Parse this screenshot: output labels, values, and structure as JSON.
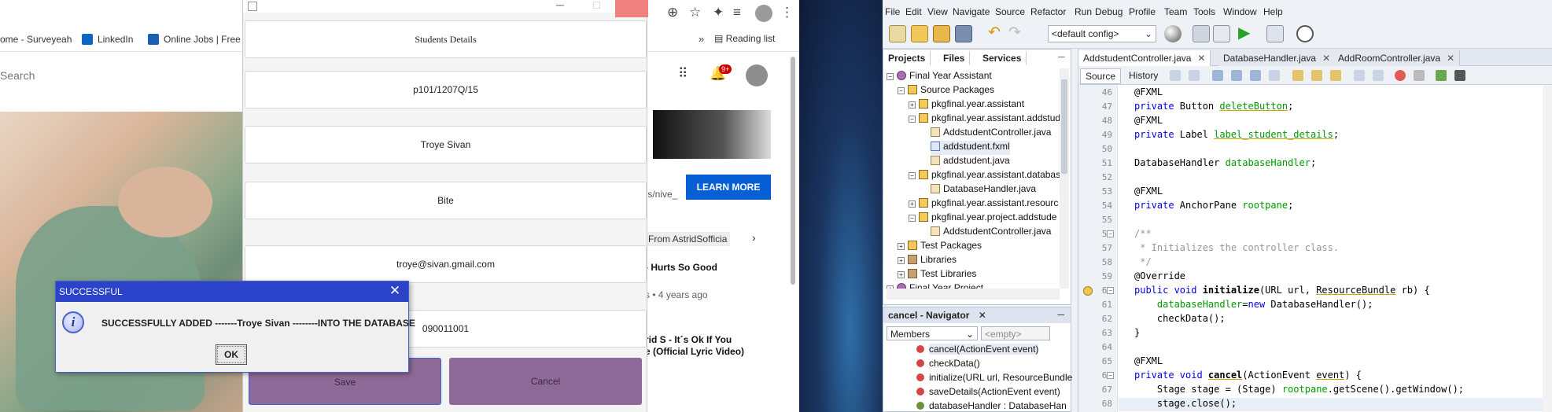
{
  "browser": {
    "bookmarks": [
      "ome - Surveyeah",
      "LinkedIn",
      "Online Jobs | Free"
    ],
    "reading_list": "Reading list",
    "search_placeholder": "Search",
    "notif_count": "9+",
    "ad_caption": "/s/nive_",
    "learn_more": "LEARN MORE",
    "chip": "From AstridSofficia",
    "video1_title": "- Hurts So Good",
    "video1_meta": "s • 4 years ago",
    "video2_title": "rid S - It´s Ok If You",
    "video2_sub": "e (Official Lyric Video)"
  },
  "fx": {
    "title_field": "Students Details",
    "id_field": "p101/1207Q/15",
    "name_field": "Troye Sivan",
    "course_field": "Bite",
    "email_field": "troye@sivan.gmail.com",
    "phone_field": "090011001",
    "save": "Save",
    "cancel": "Cancel"
  },
  "dialog": {
    "title": "SUCCESSFUL",
    "message": "SUCCESSFULLY ADDED -------Troye Sivan --------INTO THE DATABASE",
    "ok": "OK",
    "close": "✕"
  },
  "netbeans": {
    "menu": [
      "File",
      "Edit",
      "View",
      "Navigate",
      "Source",
      "Refactor",
      "Run",
      "Debug",
      "Profile",
      "Team",
      "Tools",
      "Window",
      "Help"
    ],
    "config": "<default config>",
    "project_tabs": [
      "Projects",
      "Files",
      "Services"
    ],
    "tree": [
      {
        "label": "Final Year Assistant",
        "indent": 0,
        "icon": "cup",
        "exp": "−"
      },
      {
        "label": "Source Packages",
        "indent": 1,
        "icon": "pkg",
        "exp": "−"
      },
      {
        "label": "pkgfinal.year.assistant",
        "indent": 2,
        "icon": "pkg",
        "exp": "+"
      },
      {
        "label": "pkgfinal.year.assistant.addstud",
        "indent": 2,
        "icon": "pkg",
        "exp": "−"
      },
      {
        "label": "AddstudentController.java",
        "indent": 3,
        "icon": "java",
        "exp": ""
      },
      {
        "label": "addstudent.fxml",
        "indent": 3,
        "icon": "fxml",
        "exp": ""
      },
      {
        "label": "addstudent.java",
        "indent": 3,
        "icon": "java",
        "exp": ""
      },
      {
        "label": "pkgfinal.year.assistant.databas",
        "indent": 2,
        "icon": "pkg",
        "exp": "−"
      },
      {
        "label": "DatabaseHandler.java",
        "indent": 3,
        "icon": "java",
        "exp": ""
      },
      {
        "label": "pkgfinal.year.assistant.resourc",
        "indent": 2,
        "icon": "pkg",
        "exp": "+"
      },
      {
        "label": "pkgfinal.year.project.addstude",
        "indent": 2,
        "icon": "pkg",
        "exp": "−"
      },
      {
        "label": "AddstudentController.java",
        "indent": 3,
        "icon": "java",
        "exp": ""
      },
      {
        "label": "Test Packages",
        "indent": 1,
        "icon": "pkg",
        "exp": "+"
      },
      {
        "label": "Libraries",
        "indent": 1,
        "icon": "lib",
        "exp": "+"
      },
      {
        "label": "Test Libraries",
        "indent": 1,
        "icon": "lib",
        "exp": "+"
      },
      {
        "label": "Final Year Project",
        "indent": 0,
        "icon": "cup",
        "exp": "+"
      }
    ],
    "navigator_title": "cancel - Navigator",
    "navigator_members": "Members",
    "navigator_filter": "<empty>",
    "navigator_items": [
      "cancel(ActionEvent event)",
      "checkData()",
      "initialize(URL url, ResourceBundle",
      "saveDetails(ActionEvent event)",
      "databaseHandler : DatabaseHan"
    ],
    "editor_tabs": [
      "AddstudentController.java",
      "DatabaseHandler.java",
      "AddRoomController.java"
    ],
    "editor_modes": [
      "Source",
      "History"
    ],
    "line_numbers": [
      "46",
      "47",
      "48",
      "49",
      "50",
      "51",
      "52",
      "53",
      "54",
      "55",
      "56",
      "57",
      "58",
      "59",
      "60",
      "61",
      "62",
      "63",
      "64",
      "65",
      "66",
      "67",
      "68"
    ],
    "code": {
      "l46": "@FXML",
      "l47a": "private ",
      "l47b": "Button ",
      "l47c": "deleteButton",
      "l47d": ";",
      "l48": "@FXML",
      "l49a": "private ",
      "l49b": "Label ",
      "l49c": "label_student_details",
      "l49d": ";",
      "l51a": "DatabaseHandler ",
      "l51b": "databaseHandler",
      "l51c": ";",
      "l53": "@FXML",
      "l54a": "private ",
      "l54b": "AnchorPane ",
      "l54c": "rootpane",
      "l54d": ";",
      "l56": "/**",
      "l57": " * Initializes the controller class.",
      "l58": " */",
      "l59": "@Override",
      "l60a": "public void ",
      "l60b": "initialize",
      "l60c": "(URL url, ",
      "l60d": "ResourceBundle",
      "l60e": " rb) {",
      "l61a": "    ",
      "l61b": "databaseHandler",
      "l61c": "=",
      "l61d": "new",
      "l61e": " DatabaseHandler();",
      "l62": "    checkData();",
      "l63": "}",
      "l65": "@FXML",
      "l66a": "private void ",
      "l66b": "cancel",
      "l66c": "(ActionEvent ",
      "l66d": "event",
      "l66e": ") {",
      "l67a": "    Stage stage = (Stage) ",
      "l67b": "rootpane",
      "l67c": ".getScene().getWindow();",
      "l68": "    stage.close();"
    }
  }
}
